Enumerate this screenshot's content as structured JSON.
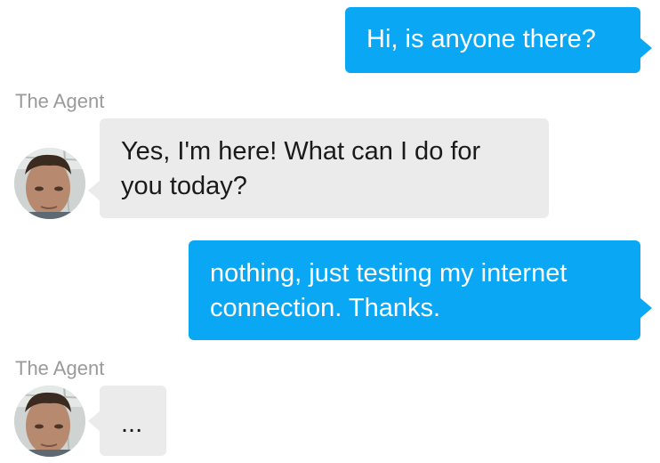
{
  "messages": {
    "m1_text": "Hi, is anyone there?",
    "m2_sender": "The Agent",
    "m2_text": "Yes, I'm here! What can I do for you today?",
    "m3_text": "nothing, just testing my internet connection. Thanks.",
    "m4_sender": "The Agent",
    "m4_text": "..."
  },
  "colors": {
    "outgoing_bubble": "#0aa7f5",
    "incoming_bubble": "#ebebeb",
    "sender_label": "#9a9a9a"
  },
  "icons": {
    "agent_avatar": "agent-avatar-photo"
  }
}
